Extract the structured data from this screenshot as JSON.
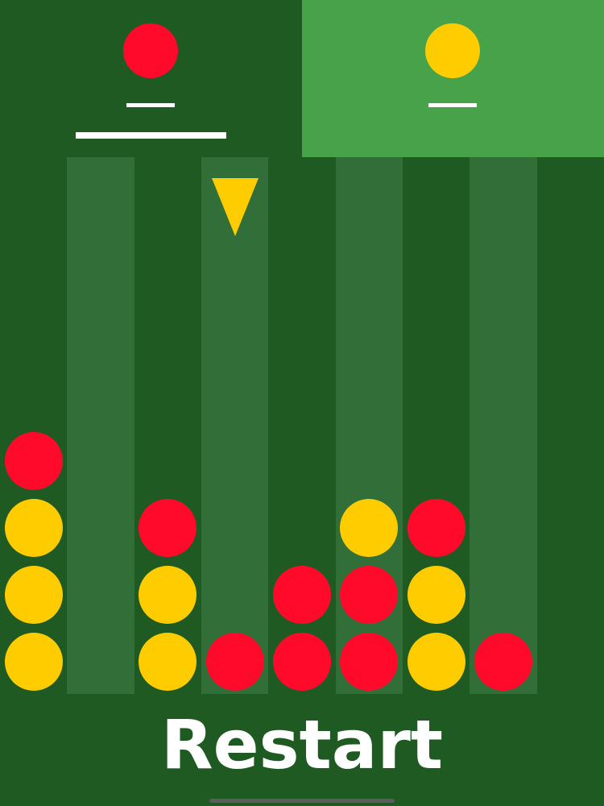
{
  "colors": {
    "red": "#ff0a2b",
    "yellow": "#ffcc00",
    "board_dark": "#1f5a22",
    "board_light": "#326e37",
    "active_panel": "#48a24a"
  },
  "players": [
    {
      "id": "player-red",
      "disc": "red",
      "score": "—",
      "active_turn": true
    },
    {
      "id": "player-yellow",
      "disc": "yellow",
      "score": "—",
      "active_turn": false
    }
  ],
  "board": {
    "columns": 9,
    "rows": 8,
    "drop_column": 3,
    "drop_color": "yellow",
    "grid": [
      [
        "yellow",
        "yellow",
        "yellow",
        "red"
      ],
      [],
      [
        "yellow",
        "yellow",
        "red"
      ],
      [
        "red"
      ],
      [
        "red",
        "red"
      ],
      [
        "red",
        "red",
        "yellow"
      ],
      [
        "yellow",
        "yellow",
        "red"
      ],
      [
        "red"
      ],
      []
    ]
  },
  "footer": {
    "restart_label": "Restart"
  }
}
